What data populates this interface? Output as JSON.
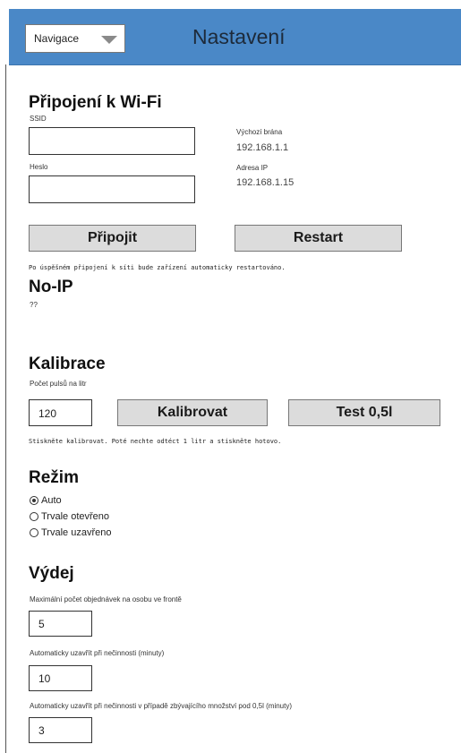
{
  "header": {
    "nav_select_value": "Navigace",
    "title": "Nastavení",
    "color": "#4a88c7"
  },
  "wifi": {
    "heading": "Připojení k Wi-Fi",
    "ssid_label": "SSID",
    "ssid_value": "",
    "password_label": "Heslo",
    "password_value": "",
    "gateway_label": "Výchozí brána",
    "gateway_value": "192.168.1.1",
    "ip_label": "Adresa IP",
    "ip_value": "192.168.1.15",
    "connect_button": "Připojit",
    "restart_button": "Restart",
    "note": "Po úspěšném připojení k síti bude zařízení automaticky restartováno."
  },
  "noip": {
    "heading": "No-IP",
    "value": "??"
  },
  "calibration": {
    "heading": "Kalibrace",
    "pulses_label": "Počet pulsů na litr",
    "pulses_value": "120",
    "calibrate_button": "Kalibrovat",
    "test_button": "Test 0,5l",
    "note": "Stiskněte kalibrovat. Poté nechte odtéct 1 litr a stiskněte hotovo."
  },
  "mode": {
    "heading": "Režim",
    "options": [
      {
        "label": "Auto",
        "selected": true
      },
      {
        "label": "Trvale otevřeno",
        "selected": false
      },
      {
        "label": "Trvale uzavřeno",
        "selected": false
      }
    ]
  },
  "dispense": {
    "heading": "Výdej",
    "max_orders_label": "Maximální počet objednávek na osobu ve frontě",
    "max_orders_value": "5",
    "auto_close_label": "Automaticky uzavřít při nečinnosti (minuty)",
    "auto_close_value": "10",
    "auto_close_low_label": "Automaticky uzavřít při nečinnosti v případě zbývajícího množství pod 0,5l (minuty)",
    "auto_close_low_value": "3"
  }
}
